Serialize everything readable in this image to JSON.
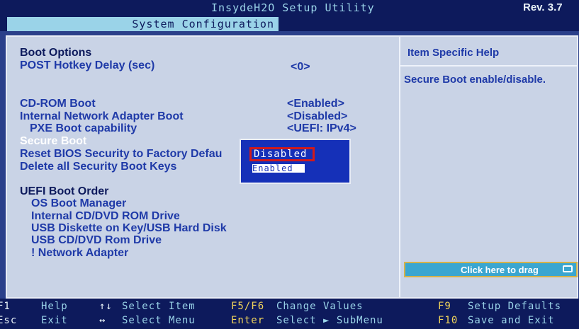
{
  "header": {
    "title": "InsydeH2O Setup Utility",
    "rev": "Rev. 3.7",
    "active_tab": "System Configuration"
  },
  "main": {
    "boot_options_heading": "Boot Options",
    "items": [
      {
        "label": "POST Hotkey Delay (sec)",
        "value": "<0>"
      },
      {
        "label": "CD-ROM Boot",
        "value": "<Enabled>"
      },
      {
        "label": "Internal Network Adapter Boot",
        "value": "<Disabled>"
      },
      {
        "label": "PXE Boot capability",
        "value": "<UEFI: IPv4>"
      },
      {
        "label": "Secure Boot",
        "value": ""
      },
      {
        "label": "Reset BIOS Security to Factory Defau",
        "value": ""
      },
      {
        "label": "Delete all Security Boot Keys",
        "value": ""
      }
    ],
    "uefi_heading": "UEFI Boot Order",
    "uefi_items": [
      "OS Boot Manager",
      "Internal CD/DVD ROM Drive",
      "USB Diskette on Key/USB Hard Disk",
      "USB CD/DVD Rom Drive",
      "! Network Adapter"
    ]
  },
  "help": {
    "title": "Item Specific Help",
    "text": "Secure Boot enable/disable."
  },
  "popup": {
    "options": [
      "Disabled",
      "Enabled"
    ],
    "selected": "Disabled"
  },
  "dragbar": {
    "label": "Click here to drag"
  },
  "footer": {
    "row1": [
      {
        "key": "F1",
        "desc": "Help"
      },
      {
        "key": "↑↓",
        "desc": "Select Item"
      },
      {
        "key": "F5/F6",
        "desc": "Change Values"
      },
      {
        "key": "F9",
        "desc": "Setup Defaults"
      }
    ],
    "row2": [
      {
        "key": "Esc",
        "desc": "Exit"
      },
      {
        "key": "↔",
        "desc": "Select Menu"
      },
      {
        "key": "Enter",
        "desc": "Select ► SubMenu"
      },
      {
        "key": "F10",
        "desc": "Save and Exit"
      }
    ]
  },
  "colors": {
    "background": "#2a3f8a",
    "panel": "#c9d3e6",
    "item_text": "#1f3aa8",
    "popup_bg": "#1530b8",
    "highlight_border": "#d21a1a",
    "drag_bar": "#3aa6d0"
  }
}
